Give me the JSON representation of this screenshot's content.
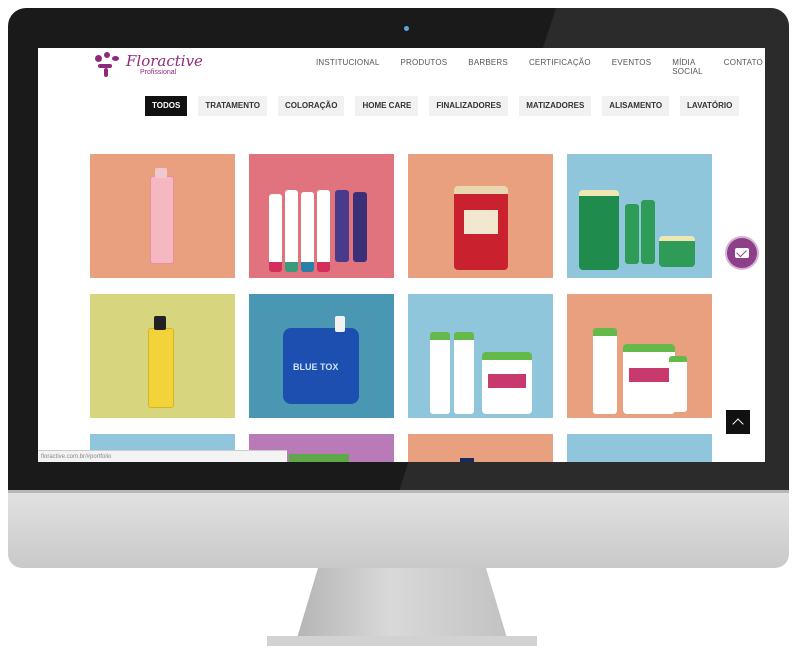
{
  "logo": {
    "name": "Floractive",
    "subtitle": "Profissional"
  },
  "nav": [
    "INSTITUCIONAL",
    "PRODUTOS",
    "BARBERS",
    "CERTIFICAÇÃO",
    "EVENTOS",
    "MÍDIA SOCIAL",
    "CONTATO"
  ],
  "filters": [
    "TODOS",
    "TRATAMENTO",
    "COLORAÇÃO",
    "HOME CARE",
    "FINALIZADORES",
    "MATIZADORES",
    "ALISAMENTO",
    "LAVATÓRIO"
  ],
  "active_filter": "TODOS",
  "tiles": [
    {
      "bg": "#e8a07e",
      "product": "pink-bottle"
    },
    {
      "bg": "#e0737e",
      "product": "developer-bottles"
    },
    {
      "bg": "#e8a07e",
      "product": "red-jar"
    },
    {
      "bg": "#8fc6db",
      "product": "green-kit"
    },
    {
      "bg": "#d7d67e",
      "product": "yellow-oil"
    },
    {
      "bg": "#4a97b4",
      "product": "blue-tox"
    },
    {
      "bg": "#8fc6db",
      "product": "pink-kit"
    },
    {
      "bg": "#e8a07e",
      "product": "pink-kit-2"
    },
    {
      "bg": "#8fc6db",
      "product": ""
    },
    {
      "bg": "#b97bb8",
      "product": ""
    },
    {
      "bg": "#e8a07e",
      "product": ""
    },
    {
      "bg": "#8fc6db",
      "product": ""
    }
  ],
  "blue_tox_label": "BLUE TOX",
  "status_url": "floractive.com.br/#portfolio",
  "colors": {
    "brand": "#8e2a7e",
    "chat": "#8e3f8a"
  }
}
